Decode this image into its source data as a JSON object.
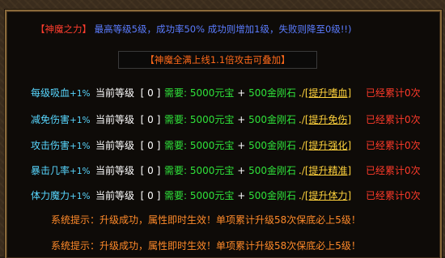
{
  "header": {
    "tag": "【神魔之力】",
    "description": "最高等级5级，成功率50% 成功则增加1级，失败则降至0级!!)"
  },
  "banner": "【神魔全满上线1.1倍攻击可叠加】",
  "rows": [
    {
      "name": "每级吸血",
      "pct": "+1%",
      "level_label": "当前等级",
      "level": "[ 0 ]",
      "cost_label": "需要:",
      "cost1": "5000元宝",
      "plus": "+",
      "cost2": "500金刚石",
      "link_prefix": "./",
      "link": "[提升嗜血]",
      "total": "已经累计0次"
    },
    {
      "name": "减免伤害",
      "pct": "+1%",
      "level_label": "当前等级",
      "level": "[ 0 ]",
      "cost_label": "需要:",
      "cost1": "5000元宝",
      "plus": "+",
      "cost2": "500金刚石",
      "link_prefix": "./",
      "link": "[提升免伤]",
      "total": "已经累计0次"
    },
    {
      "name": "攻击伤害",
      "pct": "+1%",
      "level_label": "当前等级",
      "level": "[ 0 ]",
      "cost_label": "需要:",
      "cost1": "5000元宝",
      "plus": "+",
      "cost2": "500金刚石",
      "link_prefix": "./",
      "link": "[提升强化]",
      "total": "已经累计0次"
    },
    {
      "name": "暴击几率",
      "pct": "+1%",
      "level_label": "当前等级",
      "level": "[ 0 ]",
      "cost_label": "需要:",
      "cost1": "5000元宝",
      "plus": "+",
      "cost2": "500金刚石",
      "link_prefix": "./",
      "link": "[提升精准]",
      "total": "已经累计0次"
    },
    {
      "name": "体力魔力",
      "pct": "+1%",
      "level_label": "当前等级",
      "level": "[ 0 ]",
      "cost_label": "需要:",
      "cost1": "5000元宝",
      "plus": "+",
      "cost2": "500金刚石",
      "link_prefix": "./",
      "link": "[提升体力]",
      "total": "已经累计0次"
    }
  ],
  "messages": [
    "系统提示：升级成功，属性即时生效！单项累计升级58次保底必上5级！",
    "系统提示：升级成功，属性即时生效！单项累计升级58次保底必上5级！"
  ],
  "colors": {
    "accent_red": "#ff3d2e",
    "blue": "#5b7cff",
    "cyan": "#58d7ff",
    "green": "#2fe23a",
    "gold": "#ffd23c",
    "orange": "#ff8a2a"
  }
}
